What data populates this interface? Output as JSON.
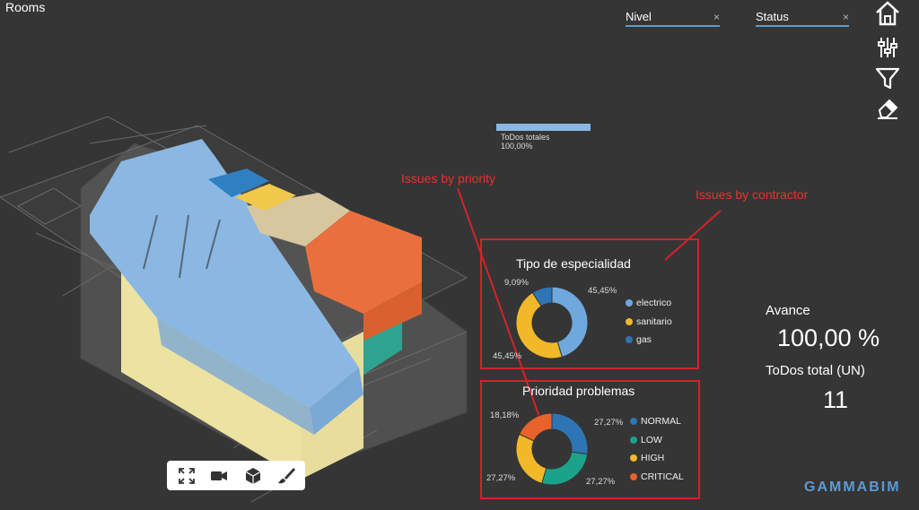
{
  "header": {
    "title": "Rooms"
  },
  "filters": [
    {
      "label": "Nivel",
      "clear": "×"
    },
    {
      "label": "Status",
      "clear": "×"
    }
  ],
  "sidebar": {
    "icons": [
      "home-icon",
      "sliders-icon",
      "filter-icon",
      "eraser-icon"
    ]
  },
  "progress": {
    "label": "ToDos totales",
    "percent_text": "100,00%",
    "fraction": 1.0
  },
  "annotations": {
    "priority": "Issues by priority",
    "contractor": "Issues by contractor"
  },
  "colors": {
    "accent": "#5b9bd5",
    "annotation_red": "#e8322f",
    "electrico": "#6fa8dc",
    "sanitario": "#f1b829",
    "gas": "#2e75b6",
    "normal": "#2e75b6",
    "low": "#1aa38a",
    "high": "#f1b829",
    "critical": "#e9622c"
  },
  "chart_data": [
    {
      "type": "pie",
      "title": "Tipo de especialidad",
      "categories": [
        "electrico",
        "sanitario",
        "gas"
      ],
      "values": [
        45.45,
        45.45,
        9.09
      ],
      "labels": [
        "45,45%",
        "45,45%",
        "9,09%"
      ],
      "legend": "right"
    },
    {
      "type": "pie",
      "title": "Prioridad problemas",
      "categories": [
        "NORMAL",
        "LOW",
        "HIGH",
        "CRITICAL"
      ],
      "values": [
        27.27,
        27.27,
        27.27,
        18.18
      ],
      "labels": [
        "27,27%",
        "27,27%",
        "27,27%",
        "18,18%"
      ],
      "legend": "right"
    }
  ],
  "stats": {
    "avance_label": "Avance",
    "avance_value": "100,00 %",
    "todos_label": "ToDos total (UN)",
    "todos_value": "11"
  },
  "toolbar": {
    "icons": [
      "expand-icon",
      "camera-icon",
      "cube-icon",
      "brush-icon"
    ]
  },
  "logo": {
    "text": "GAMMABIM"
  }
}
